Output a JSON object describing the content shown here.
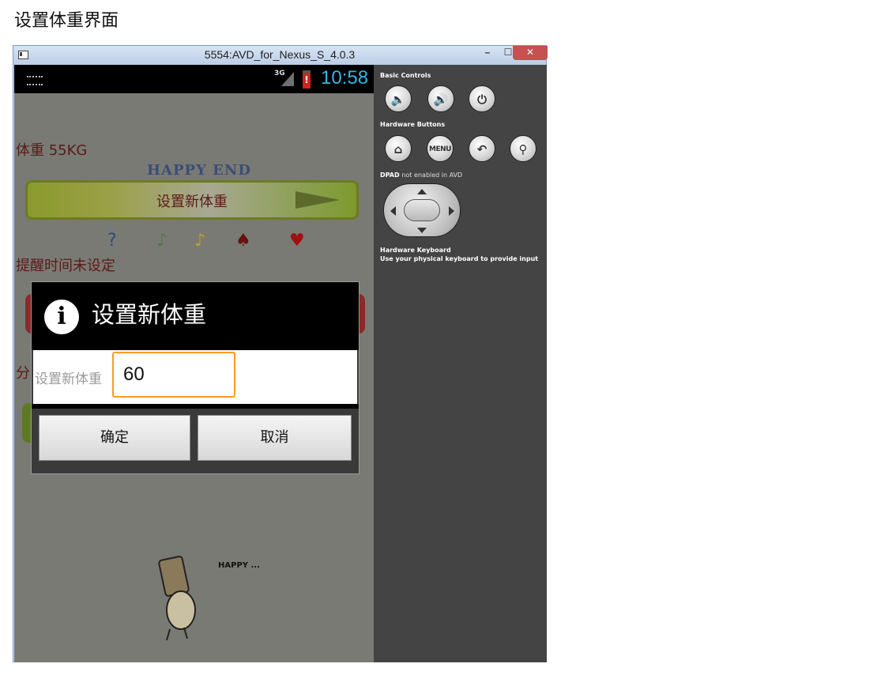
{
  "document": {
    "heading": "设置体重界面"
  },
  "window": {
    "title": "5554:AVD_for_Nexus_S_4.0.3",
    "minimize_icon": "minimize-icon",
    "maximize_icon": "maximize-icon",
    "close_icon": "close-icon"
  },
  "status_bar": {
    "network": "3G",
    "time": "10:58",
    "battery_glyph": "!"
  },
  "app": {
    "weight_text": "体重 55KG",
    "happy_end": "HAPPY END",
    "set_weight_button": "设置新体重",
    "reminder_text": "提醒时间未设定",
    "share_text": "分",
    "happy_caption": "HAPPY ..."
  },
  "dialog": {
    "title": "设置新体重",
    "info_glyph": "i",
    "field_label": "设置新体重",
    "input_value": "60",
    "ok_label": "确定",
    "cancel_label": "取消"
  },
  "controls": {
    "basic_controls_label": "Basic Controls",
    "hardware_buttons_label": "Hardware Buttons",
    "dpad_label": "DPAD",
    "dpad_note": "not enabled in AVD",
    "hardware_keyboard_label": "Hardware Keyboard",
    "hardware_keyboard_hint": "Use your physical keyboard to provide input",
    "menu_label": "MENU",
    "glyphs": {
      "volume_down": "🔈",
      "volume_up": "🔊",
      "power": "⏻",
      "home": "⌂",
      "back": "↶",
      "search": "⚲"
    }
  },
  "colors": {
    "status_clock": "#33b5e5",
    "input_focus": "#ff9a20",
    "close_button": "#c75050",
    "app_text": "#5c1a1a",
    "controls_bg": "#444444"
  }
}
